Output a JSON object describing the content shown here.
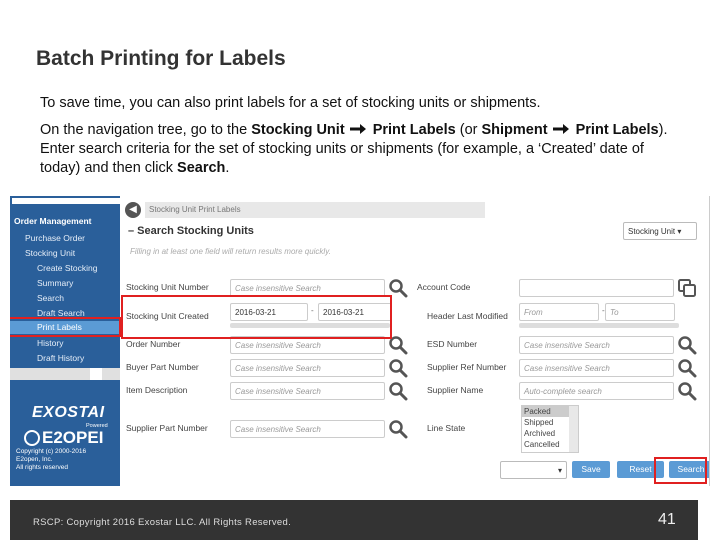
{
  "slide": {
    "title": "Batch Printing for Labels",
    "para1": "To save time, you can also print labels for a set of stocking units or shipments.",
    "para2_a": "On the navigation tree, go to the ",
    "para2_b1": "Stocking Unit",
    "para2_b2": " Print Labels",
    "para2_c": " (or ",
    "para2_d1": "Shipment",
    "para2_d2": " Print Labels",
    "para2_e": ").  Enter search criteria for the set of stocking units or shipments (for example, a ‘Created’ date of today) and then click ",
    "para2_f": "Search",
    "para2_g": ".",
    "footer": "RSCP: Copyright 2016 Exostar LLC. All Rights Reserved.",
    "page_number": "41"
  },
  "sidebar": {
    "header": "Order Management",
    "items": [
      {
        "label": "Purchase Order"
      },
      {
        "label": "Stocking Unit"
      },
      {
        "label": "Create Stocking"
      },
      {
        "label": "Summary"
      },
      {
        "label": "Search"
      },
      {
        "label": "Draft Search"
      },
      {
        "label": "Print Labels"
      },
      {
        "label": "History"
      },
      {
        "label": "Draft History"
      }
    ],
    "logo_primary": "EXOSTAI",
    "logo_powered": "Powered",
    "logo_secondary": "E2OPEI",
    "copyright_lines": [
      "Copyright (c) 2000-2016",
      "E2open, Inc.",
      "All rights reserved"
    ]
  },
  "main": {
    "tab_label": "Stocking Unit Print Labels",
    "section_title": "– Search Stocking Units",
    "hint": "Filling in at least one field will return results more quickly.",
    "type_dropdown": "Stocking Unit ▾",
    "fields": {
      "stocking_unit_number": {
        "label": "Stocking Unit Number",
        "placeholder": "Case insensitive Search"
      },
      "stocking_unit_created": {
        "label": "Stocking Unit Created",
        "from": "2016-03-21",
        "to": "2016-03-21"
      },
      "order_number": {
        "label": "Order Number",
        "placeholder": "Case insensitive Search"
      },
      "buyer_part_number": {
        "label": "Buyer Part Number",
        "placeholder": "Case insensitive Search"
      },
      "item_description": {
        "label": "Item Description",
        "placeholder": "Case insensitive Search"
      },
      "supplier_part_number": {
        "label": "Supplier Part Number",
        "placeholder": "Case insensitive Search"
      },
      "account_code": {
        "label": "Account Code",
        "placeholder": ""
      },
      "header_last_modified": {
        "label": "Header Last Modified",
        "from": "From",
        "to": "To"
      },
      "esd_number": {
        "label": "ESD Number",
        "placeholder": "Case insensitive Search"
      },
      "supplier_ref_number": {
        "label": "Supplier Ref Number",
        "placeholder": "Case insensitive Search"
      },
      "supplier_name": {
        "label": "Supplier Name",
        "placeholder": "Auto-complete search"
      },
      "line_state": {
        "label": "Line State",
        "options": [
          "Packed",
          "Shipped",
          "Archived",
          "Cancelled"
        ]
      }
    },
    "saved_dropdown": "▾",
    "buttons": {
      "save": "Save",
      "reset": "Reset",
      "search": "Search"
    }
  },
  "colors": {
    "sidebar_bg": "#2a5f9a",
    "accent": "#5b9bd5",
    "highlight": "#e02020"
  },
  "icons": [
    "right-arrow-icon",
    "back-arrow-icon",
    "magnifier-icon",
    "copy-icon"
  ]
}
